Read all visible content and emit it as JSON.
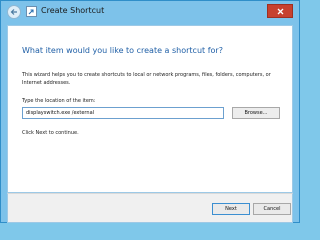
{
  "window": {
    "title": "Create Shortcut"
  },
  "content": {
    "heading": "What item would you like to create a shortcut for?",
    "description": "This wizard helps you to create shortcuts to local or network programs, files, folders, computers, or Internet addresses.",
    "location_label": "Type the location of the item:",
    "location_value": "displayswitch.exe /external",
    "browse_label": "Browse...",
    "hint": "Click Next to continue."
  },
  "footer": {
    "next_label": "Next",
    "cancel_label": "Cancel"
  },
  "icons": {
    "back": "back-arrow-icon",
    "app": "shortcut-icon",
    "close": "close-icon"
  },
  "colors": {
    "title_bar": "#7dc2ea",
    "heading": "#1f5fa6",
    "close_button": "#c7412f"
  }
}
